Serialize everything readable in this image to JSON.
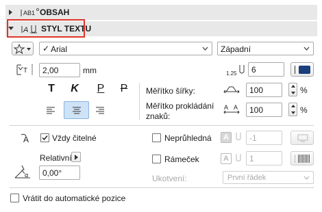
{
  "sections": {
    "obsah": {
      "title": "OBSAH",
      "icon_text": "AB1"
    },
    "styl": {
      "title": "STYL TEXTU",
      "highlight_color": "#e0342a"
    }
  },
  "font": {
    "name": "Arial",
    "charset": "Západní"
  },
  "size": {
    "value": "2,00",
    "unit": "mm"
  },
  "pen": {
    "value": "6",
    "pen_label": "1.25"
  },
  "styles": {
    "bold": "T",
    "italic": "K",
    "underline": "P",
    "strike": "P"
  },
  "width_scale": {
    "label": "Měřítko šířky:",
    "value": "100",
    "unit": "%"
  },
  "spacing_scale": {
    "label_line1": "Měřítko prokládání",
    "label_line2": "znaků:",
    "value": "100",
    "unit": "%"
  },
  "always_readable": {
    "label": "Vždy čitelné",
    "checked": true
  },
  "opaque": {
    "label": "Neprůhledná",
    "value": "-1"
  },
  "frame": {
    "label": "Rámeček",
    "value": "1"
  },
  "rotation": {
    "mode": "Relativní",
    "value": "0,00°"
  },
  "anchor": {
    "label": "Ukotvení:",
    "value": "První řádek"
  },
  "auto_position": {
    "label": "Vrátit do automatické pozice"
  },
  "colors": {
    "accent": "#1a3f7a",
    "selected_bg": "#cfe3f7"
  }
}
